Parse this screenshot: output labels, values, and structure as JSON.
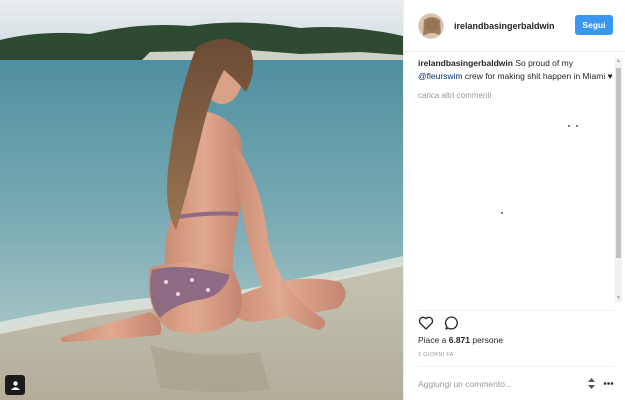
{
  "post": {
    "username": "irelandbasingerbaldwin",
    "follow_label": "Segui"
  },
  "caption": {
    "username": "irelandbasingerbaldwin",
    "text_before": "So proud of my ",
    "mention": "@fleurswim",
    "text_after": " crew for making shit happen in Miami ♥"
  },
  "comments": {
    "load_more": "carica altri commenti"
  },
  "actions": {
    "like_icon": "heart-icon",
    "comment_icon": "comment-bubble-icon"
  },
  "likes": {
    "label": "Piace a",
    "count": "6.871",
    "unit": "persone"
  },
  "timestamp": "2 GIORNI FA",
  "comment_box": {
    "placeholder": "Aggiungi un commento..."
  },
  "colors": {
    "accent": "#3897f0",
    "mention": "#003569",
    "muted": "#999999"
  }
}
